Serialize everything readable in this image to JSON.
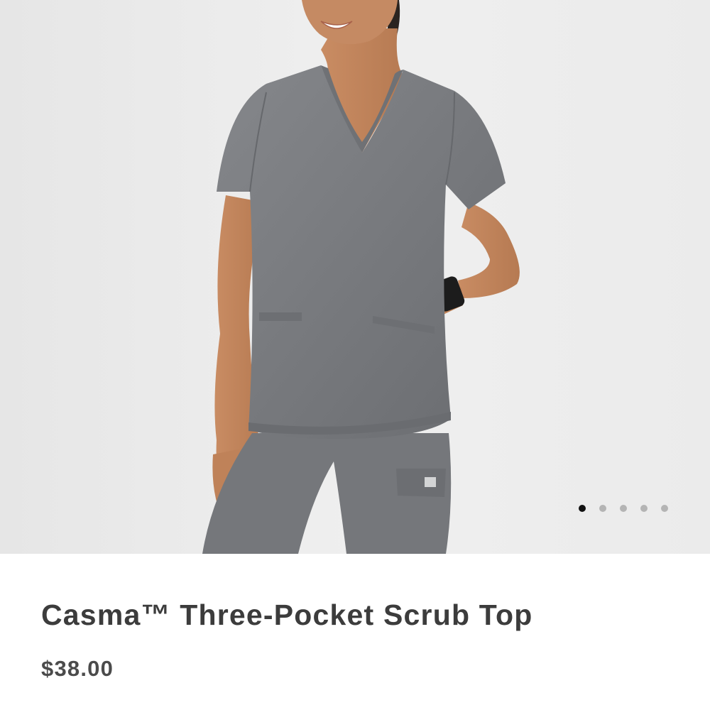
{
  "product": {
    "title": "Casma™ Three-Pocket Scrub Top",
    "price": "$38.00"
  },
  "gallery": {
    "image_subject": "model-wearing-gray-scrub-top",
    "slide_count": 5,
    "active_slide": 1,
    "dot_colors": {
      "active": "#111111",
      "inactive": "#b4b4b4"
    }
  },
  "colors": {
    "gallery_background": "#ececec",
    "scrub_fabric": "#7c7e82",
    "title_text": "#3c3c3c",
    "price_text": "#4b4b4b"
  }
}
